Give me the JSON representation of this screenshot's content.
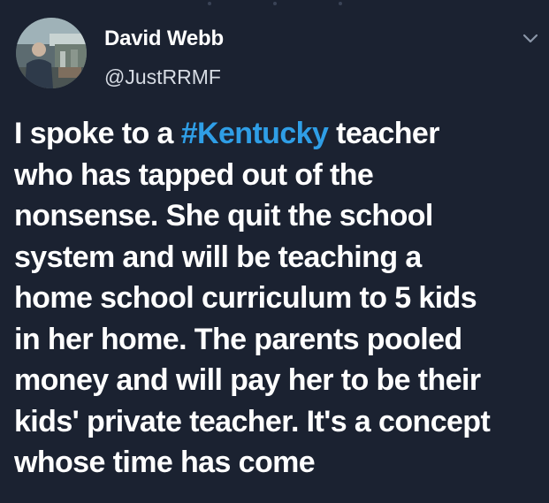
{
  "theme": {
    "background": "#1b2231",
    "text": "#ffffff",
    "handle_color": "#d6dbe3",
    "hashtag_color": "#2f9ee6"
  },
  "tweet": {
    "author": {
      "name": "David Webb",
      "handle": "@JustRRMF",
      "avatar_icon": "user-photo-avatar"
    },
    "menu_icon": "chevron-down-icon",
    "text": {
      "line1_prefix": "I spoke to a ",
      "hashtag": "#Kentucky",
      "line1_suffix": " teacher",
      "line2": "who has tapped out of the",
      "line3": "nonsense. She quit the school",
      "line4": "system and will be teaching a",
      "line5": "home school curriculum to 5 kids",
      "line6": "in her home. The parents pooled",
      "line7": "money and will pay her to be their",
      "line8": "kids' private teacher. It's a concept",
      "line9": "whose time has come"
    }
  }
}
